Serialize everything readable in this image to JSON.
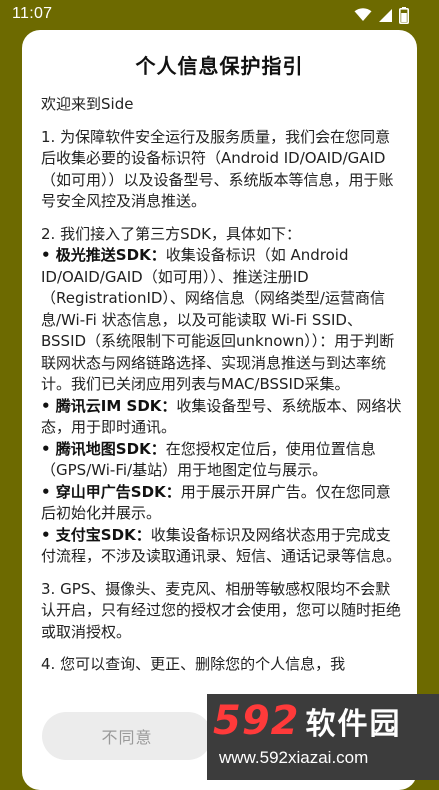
{
  "status_bar": {
    "time": "11:07"
  },
  "dialog": {
    "title": "个人信息保护指引",
    "welcome": "欢迎来到Side",
    "para1": "1. 为保障软件安全运行及服务质量，我们会在您同意后收集必要的设备标识符（Android ID/OAID/GAID（如可用））以及设备型号、系统版本等信息，用于账号安全风控及消息推送。",
    "para2_intro": "2. 我们接入了第三方SDK，具体如下：",
    "sdk_items": [
      {
        "name": "• 极光推送SDK：",
        "desc": "收集设备标识（如 Android ID/OAID/GAID（如可用））、推送注册ID（RegistrationID）、网络信息（网络类型/运营商信息/Wi-Fi 状态信息，以及可能读取 Wi-Fi SSID、BSSID（系统限制下可能返回unknown））：用于判断联网状态与网络链路选择、实现消息推送与到达率统计。我们已关闭应用列表与MAC/BSSID采集。"
      },
      {
        "name": "• 腾讯云IM SDK：",
        "desc": "收集设备型号、系统版本、网络状态，用于即时通讯。"
      },
      {
        "name": "• 腾讯地图SDK：",
        "desc": "在您授权定位后，使用位置信息（GPS/Wi-Fi/基站）用于地图定位与展示。"
      },
      {
        "name": "• 穿山甲广告SDK：",
        "desc": "用于展示开屏广告。仅在您同意后初始化并展示。"
      },
      {
        "name": "• 支付宝SDK：",
        "desc": "收集设备标识及网络状态用于完成支付流程，不涉及读取通讯录、短信、通话记录等信息。"
      }
    ],
    "para3": "3. GPS、摄像头、麦克风、相册等敏感权限均不会默认开启，只有经过您的授权才会使用，您可以随时拒绝或取消授权。",
    "para4_partial": "4. 您可以查询、更正、删除您的个人信息，我",
    "disagree_label": "不同意"
  },
  "watermark": {
    "number": "592",
    "name": "软件园",
    "url": "www.592xiazai.com"
  },
  "colors": {
    "background": "#6d6a00",
    "dialog": "#ffffff",
    "watermark_red": "#ff3a3a"
  }
}
